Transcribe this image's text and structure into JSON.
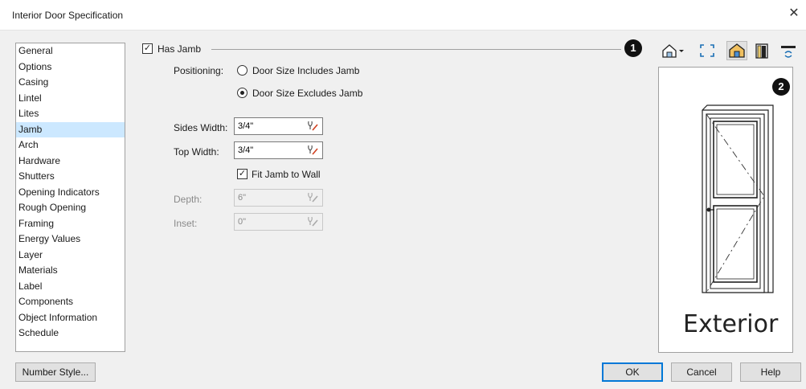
{
  "window": {
    "title": "Interior Door Specification",
    "close_glyph": "✕"
  },
  "sidebar": {
    "items": [
      "General",
      "Options",
      "Casing",
      "Lintel",
      "Lites",
      "Jamb",
      "Arch",
      "Hardware",
      "Shutters",
      "Opening Indicators",
      "Rough Opening",
      "Framing",
      "Energy Values",
      "Layer",
      "Materials",
      "Label",
      "Components",
      "Object Information",
      "Schedule"
    ],
    "selected": "Jamb"
  },
  "jamb": {
    "has_jamb_label": "Has Jamb",
    "has_jamb_checked": true,
    "positioning_label": "Positioning:",
    "radio_includes": "Door Size Includes Jamb",
    "radio_excludes": "Door Size Excludes Jamb",
    "selected_radio": "excludes",
    "sides_width_label": "Sides Width:",
    "sides_width_value": "3/4\"",
    "top_width_label": "Top Width:",
    "top_width_value": "3/4\"",
    "fit_jamb_label": "Fit Jamb to Wall",
    "fit_jamb_checked": true,
    "depth_label": "Depth:",
    "depth_value": "6\"",
    "inset_label": "Inset:",
    "inset_value": "0\""
  },
  "callouts": {
    "one": "1",
    "two": "2"
  },
  "preview": {
    "caption": "Exterior"
  },
  "footer": {
    "number_style": "Number Style...",
    "ok": "OK",
    "cancel": "Cancel",
    "help": "Help"
  },
  "icons": [
    "view-angle-dropdown-icon",
    "fill-window-icon",
    "color-mode-icon",
    "show-jamb-icon",
    "swap-side-icon",
    "calculator-icon"
  ]
}
